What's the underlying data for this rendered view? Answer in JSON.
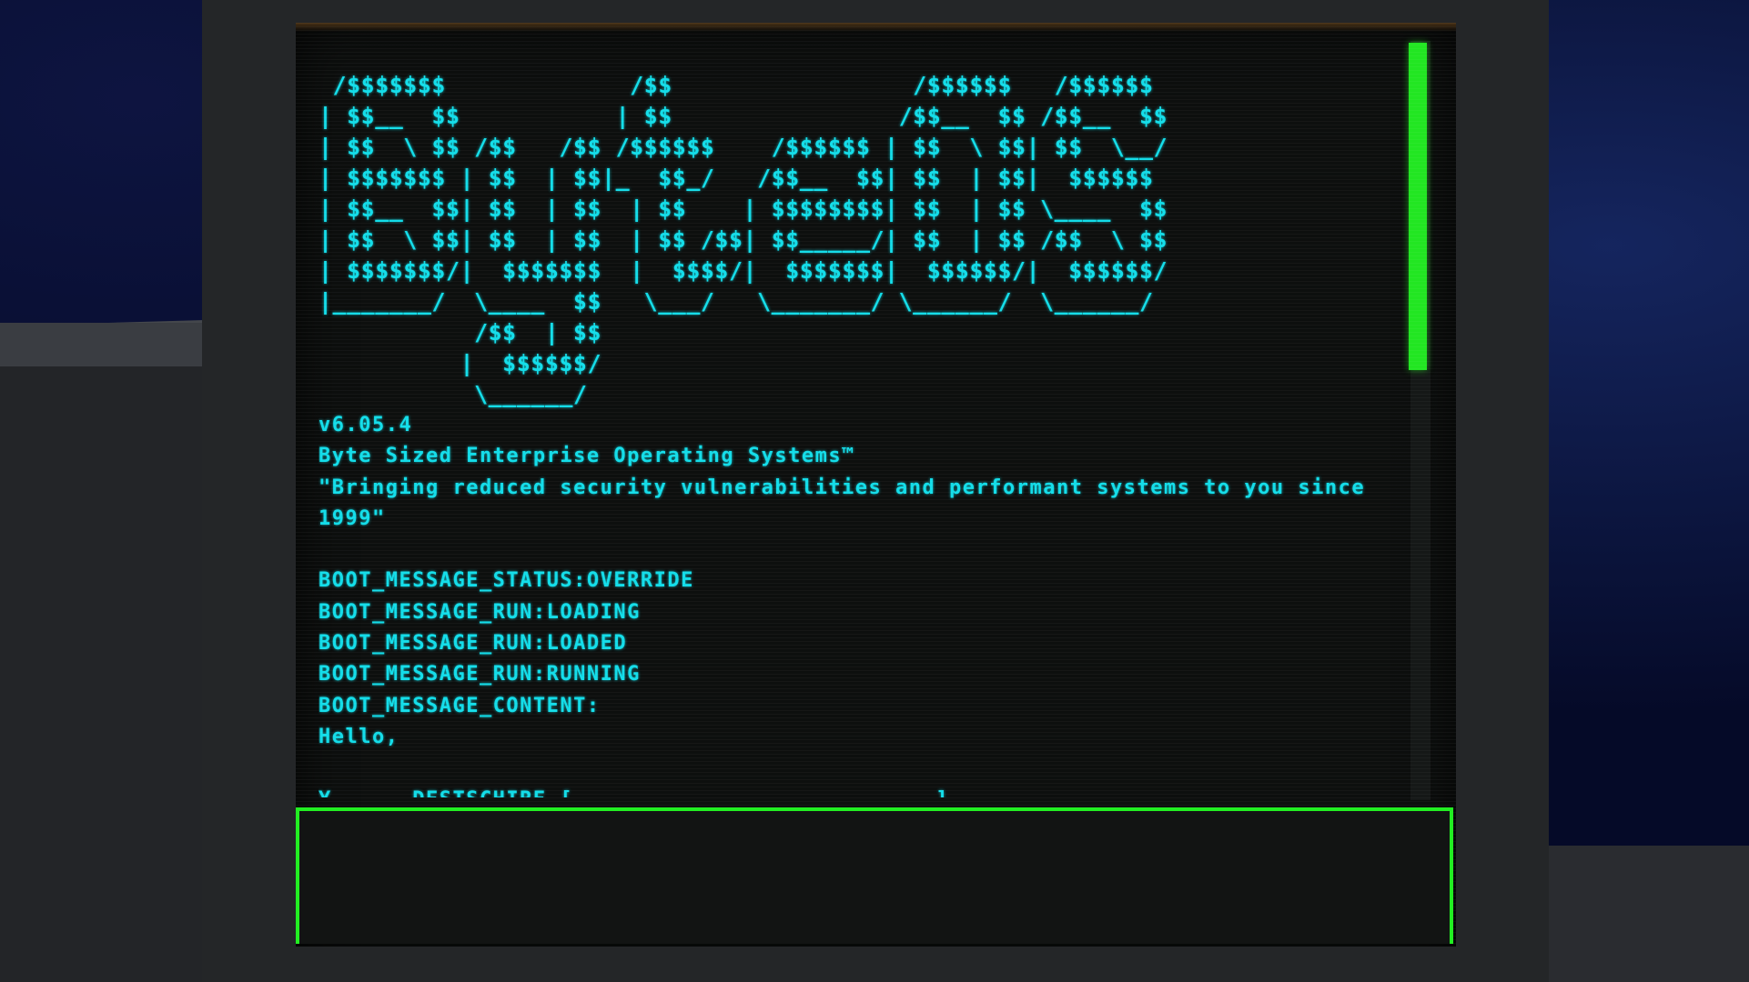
{
  "terminal": {
    "ascii_logo": " /$$$$$$$             /$$                 /$$$$$$   /$$$$$$ \n| $$__  $$           | $$                /$$__  $$ /$$__  $$\n| $$  \\ $$ /$$   /$$ /$$$$$$    /$$$$$$ | $$  \\ $$| $$  \\__/\n| $$$$$$$ | $$  | $$|_  $$_/   /$$__  $$| $$  | $$|  $$$$$$ \n| $$__  $$| $$  | $$  | $$    | $$$$$$$$| $$  | $$ \\____  $$\n| $$  \\ $$| $$  | $$  | $$ /$$| $$_____/| $$  | $$ /$$  \\ $$\n| $$$$$$$/|  $$$$$$$  |  $$$$/|  $$$$$$$|  $$$$$$/|  $$$$$$/\n|_______/  \\____  $$   \\___/   \\_______/ \\______/  \\______/ \n           /$$  | $$                                        \n          |  $$$$$$/                                        \n           \\______/                                         ",
    "version": "v6.05.4",
    "company": "Byte Sized Enterprise Operating Systems™",
    "tagline": "\"Bringing reduced security vulnerabilities and performant systems to you since 1999\"",
    "boot_lines": [
      "BOOT_MESSAGE_STATUS:OVERRIDE",
      "BOOT_MESSAGE_RUN:LOADING",
      "BOOT_MESSAGE_RUN:LOADED",
      "BOOT_MESSAGE_RUN:RUNNING",
      "BOOT_MESSAGE_CONTENT:",
      "Hello,"
    ],
    "partial_line": "Y      DESTSCHIRE [                           ]"
  },
  "input": {
    "value": "",
    "placeholder": ""
  },
  "colors": {
    "text": "#13dde9",
    "accent": "#22ee22",
    "screen_bg": "#0d0f0e"
  }
}
